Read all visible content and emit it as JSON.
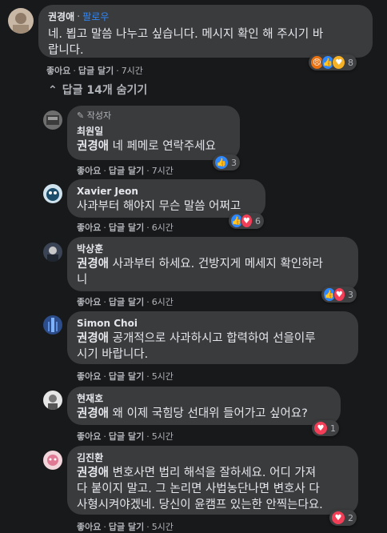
{
  "top_comment": {
    "author": "권경애",
    "follow": "팔로우",
    "text": "네. 뵙고 말씀 나누고 싶습니다. 메시지 확인 해 주시기 바\n랍니다.",
    "like": "좋아요",
    "reply": "답글 달기",
    "time": "7시간",
    "reaction_count": "8"
  },
  "collapse_label": "답글 14개 숨기기",
  "replies": [
    {
      "badge": "작성자",
      "author": "최원일",
      "mention": "권경애",
      "text": " 네 페메로 연락주세요",
      "like": "좋아요",
      "reply": "답글 달기",
      "time": "7시간",
      "reaction_count": "3"
    },
    {
      "author": "Xavier Jeon",
      "text": "사과부터 해야지 무슨 말씀 어쩌고",
      "like": "좋아요",
      "reply": "답글 달기",
      "time": "6시간",
      "reaction_count": "6"
    },
    {
      "author": "박상훈",
      "mention": "권경애",
      "text": " 사과부터 하세요. 건방지게 메세지 확인하라\n니",
      "like": "좋아요",
      "reply": "답글 달기",
      "time": "6시간",
      "reaction_count": "3"
    },
    {
      "author": "Simon Choi",
      "mention": "권경애",
      "text": " 공개적으로 사과하시고 합력하여 선을이루\n시기 바랍니다.",
      "like": "좋아요",
      "reply": "답글 달기",
      "time": "5시간"
    },
    {
      "author": "현재호",
      "mention": "권경애",
      "text": " 왜 이제 국힘당 선대위 들어가고 싶어요?",
      "like": "좋아요",
      "reply": "답글 달기",
      "time": "5시간",
      "reaction_count": "1"
    },
    {
      "author": "김진환",
      "mention": "권경애",
      "text": " 변호사면 법리 해석을 잘하세요. 어디 가져\n다 붙이지 말고. 그 논리면 사법농단나면 변호사 다\n사형시켜야겠네. 당신이 윤캠프 있는한 안찍는다요.",
      "like": "좋아요",
      "reply": "답글 달기",
      "time": "5시간",
      "reaction_count": "2"
    }
  ],
  "colors": {
    "background": "#18191a",
    "bubble": "#3a3b3c",
    "link": "#2d88ff"
  }
}
